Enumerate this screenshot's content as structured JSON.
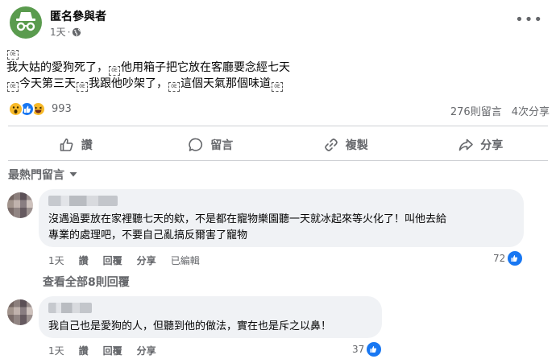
{
  "post": {
    "author": "匿名參與者",
    "time": "1天",
    "tofu_glyph": "0E",
    "line1_a": "我大姑的愛狗死了，",
    "line1_b": "他用箱子把它放在客廳要念經七天",
    "line2_a": "今天第三天",
    "line2_b": "我跟他吵架了，",
    "line2_c": "這個天氣那個味道"
  },
  "stats": {
    "reaction_count": "993",
    "comments": "276則留言",
    "shares": "4次分享"
  },
  "actions": {
    "like": "讚",
    "comment": "留言",
    "copy": "複製",
    "share": "分享"
  },
  "sort_label": "最熱門留言",
  "comments": [
    {
      "text_line1": "沒遇過要放在家裡聽七天的欸，不是都在寵物樂園聽一天就冰起來等火化了！叫他去給",
      "text_line2": "專業的處理吧，不要自己亂搞反爾害了寵物",
      "time": "1天",
      "like": "讚",
      "reply": "回覆",
      "share": "分享",
      "edited": "已編輯",
      "likes": "72"
    },
    {
      "text_line1": "我自己也是愛狗的人，但聽到他的做法，實在也是斥之以鼻！",
      "time": "1天",
      "like": "讚",
      "reply": "回覆",
      "share": "分享",
      "likes": "37"
    }
  ],
  "view_all_replies": "查看全部8則回覆",
  "colors": {
    "secondary_text": "#65676b",
    "bubble_bg": "#f0f2f5",
    "facebook_blue": "#1877f2",
    "avatar_green": "#5a9b4e"
  }
}
